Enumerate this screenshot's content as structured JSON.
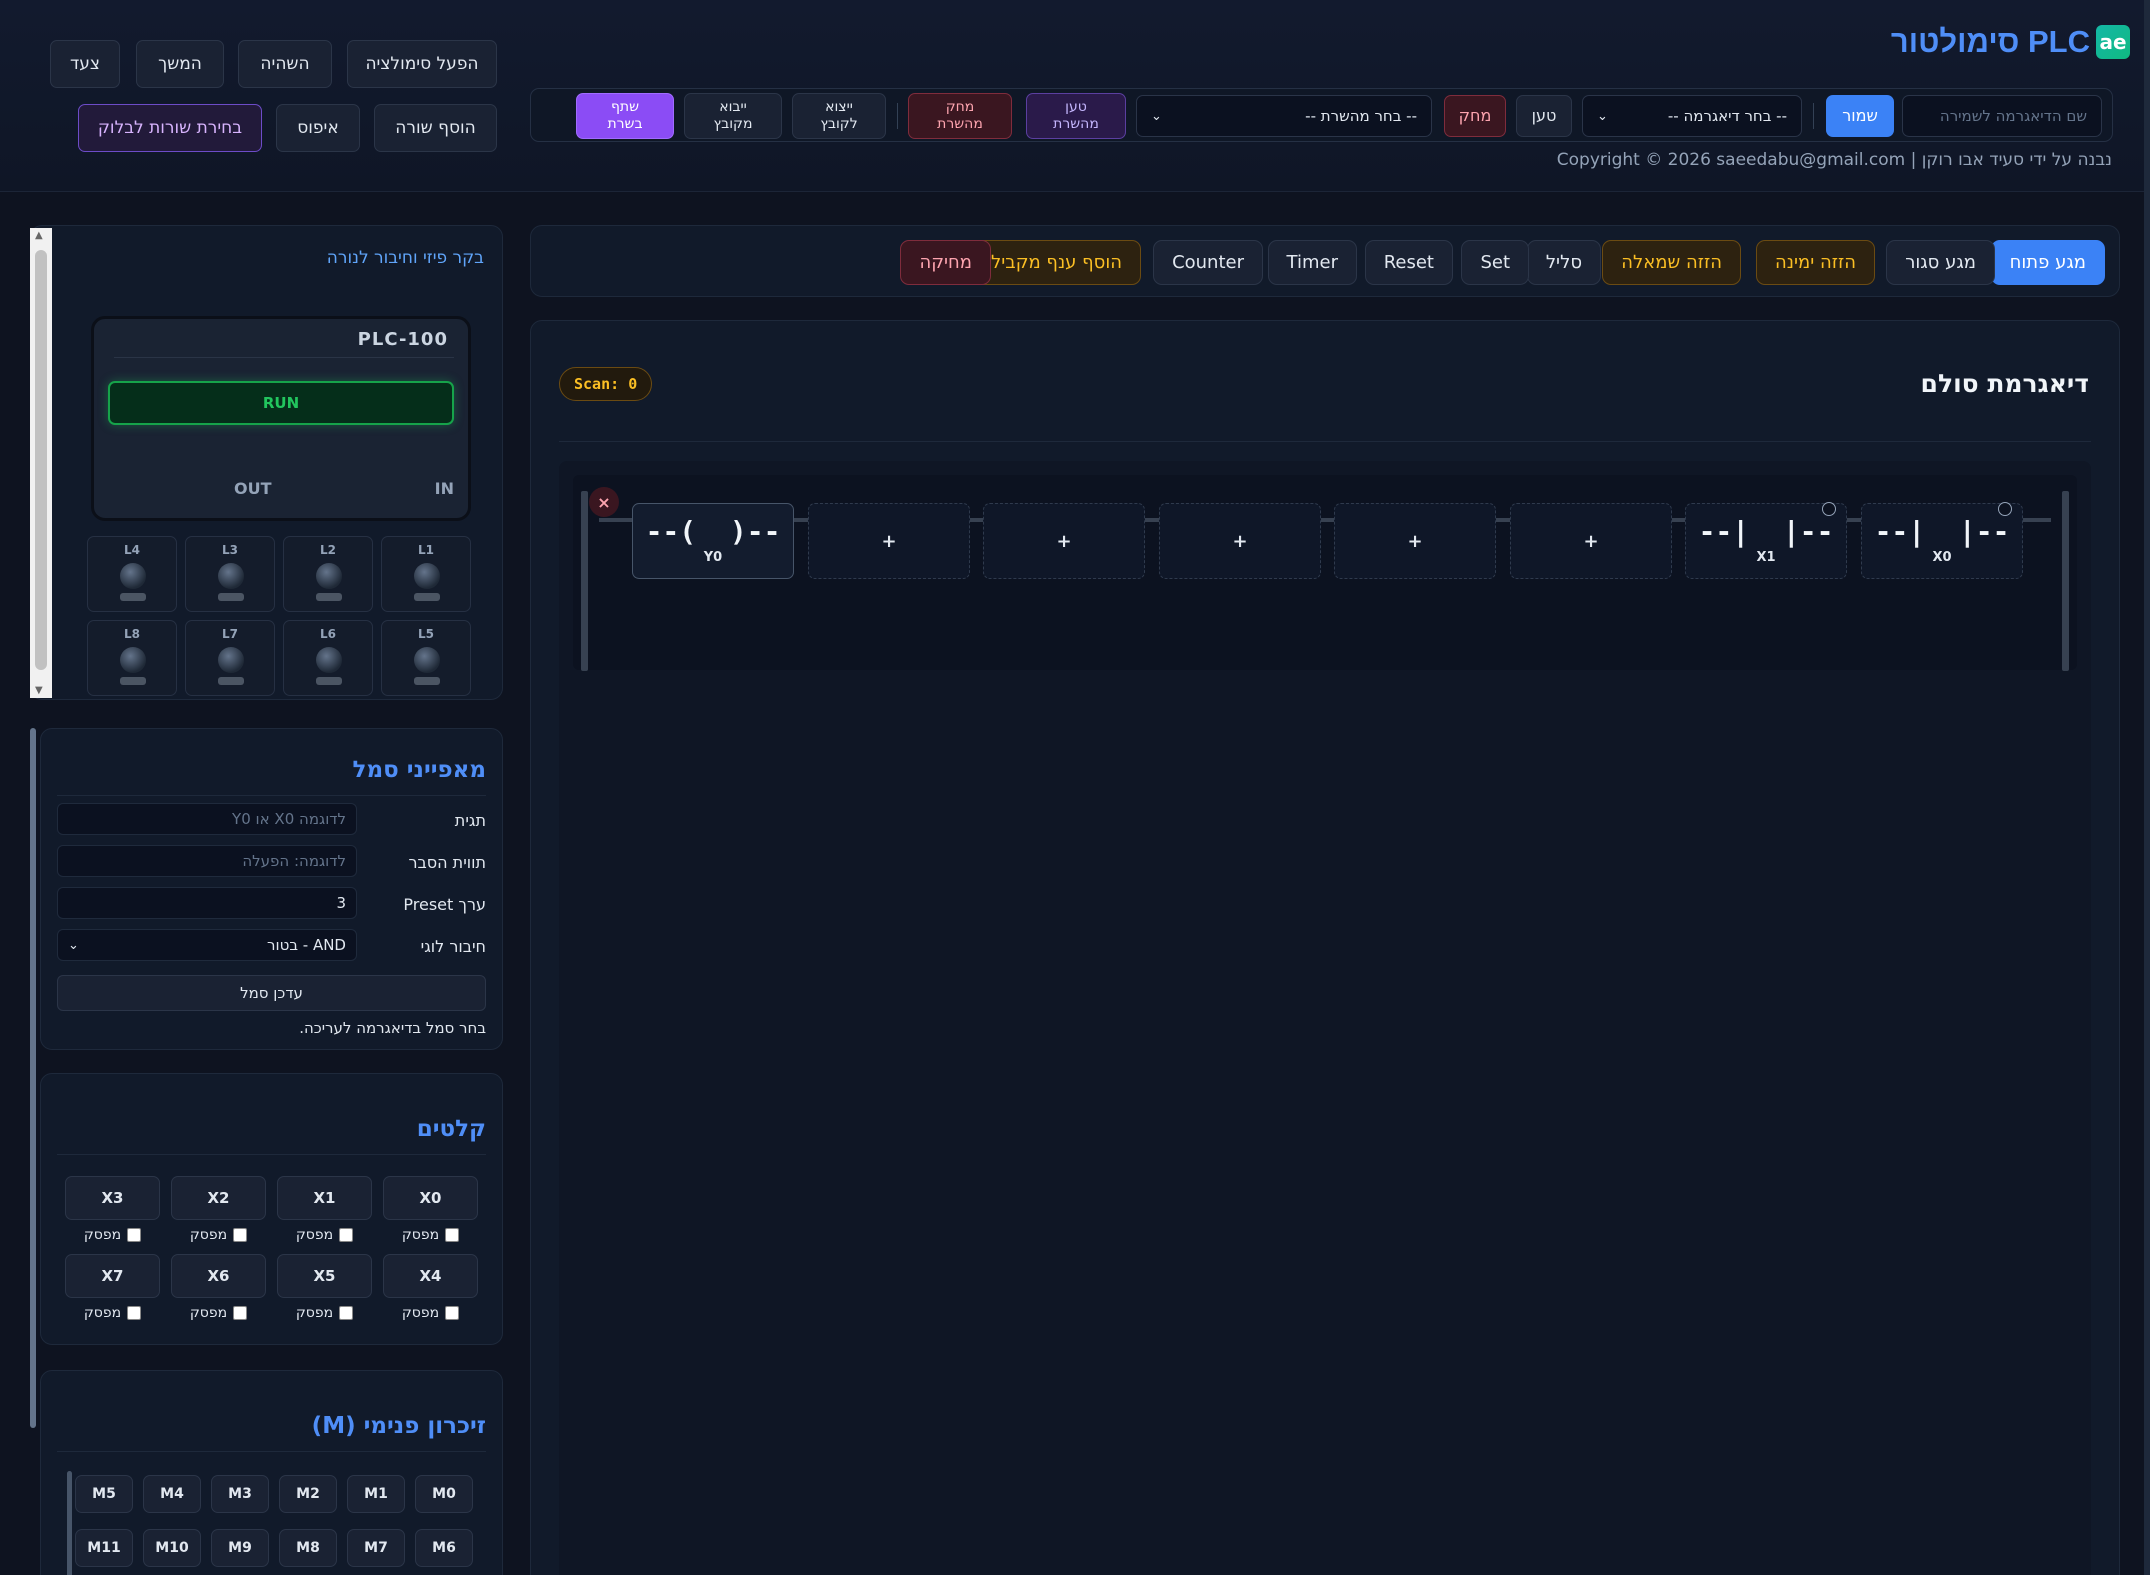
{
  "app": {
    "brand_name": "PLC סימולטור",
    "brand_badge": "ae",
    "copyright": "נבנה על ידי סעיד אבו רוקן | Copyright © 2026 saeedabu@gmail.com"
  },
  "savebar": {
    "name_placeholder": "שם הדיאגרמה לשמירה",
    "save": "שמור",
    "diagram_select": "-- בחר דיאגרמה --",
    "load": "טען",
    "delete": "מחק",
    "version_select": "-- בחר מהשרת --",
    "load_server_1": "טען",
    "load_server_2": "מהשרת",
    "delete_server_1": "מחק",
    "delete_server_2": "מהשרת",
    "export_1": "ייצוא",
    "export_2": "לקובץ",
    "import_1": "ייבוא",
    "import_2": "מקובץ",
    "share_1": "שתף",
    "share_2": "בשרת"
  },
  "sim_controls": {
    "start": "הפעל סימולציה",
    "pause": "השהיה",
    "resume": "המשך",
    "step": "צעד",
    "add_row": "הוסף שורה",
    "reset": "איפוס",
    "select_rows": "בחירת שורות לבלוק"
  },
  "toolbar": {
    "no_contact": "מגע פתוח",
    "nc_contact": "מגע סגור",
    "shift_right": "הזזה ימינה",
    "shift_left": "הזזה שמאלה",
    "coil": "סליל",
    "set": "Set",
    "reset": "Reset",
    "timer": "Timer",
    "counter": "Counter",
    "add_parallel": "הוסף ענף מקביל",
    "erase": "מחיקה"
  },
  "ladder": {
    "title": "דיאגרמת סולם",
    "scan_label": "Scan:",
    "scan_value": "0",
    "delete_rung": "×",
    "cells": [
      {
        "symbol": "--|  |--",
        "tag": "X0",
        "type": "contact"
      },
      {
        "symbol": "--|  |--",
        "tag": "X1",
        "type": "contact"
      },
      {
        "symbol": "+",
        "tag": "",
        "type": "empty"
      },
      {
        "symbol": "+",
        "tag": "",
        "type": "empty"
      },
      {
        "symbol": "+",
        "tag": "",
        "type": "empty"
      },
      {
        "symbol": "+",
        "tag": "",
        "type": "empty"
      },
      {
        "symbol": "+",
        "tag": "",
        "type": "empty"
      },
      {
        "symbol": "--(  )--",
        "tag": "Y0",
        "type": "coil"
      }
    ]
  },
  "plc": {
    "title": "בקר פיזי וחיבור לנורה",
    "model": "PLC-100",
    "status": "RUN",
    "in_label": "IN",
    "out_label": "OUT",
    "lamps": [
      "L1",
      "L2",
      "L3",
      "L4",
      "L5",
      "L6",
      "L7",
      "L8"
    ]
  },
  "props": {
    "title": "מאפייני סמל",
    "tag_label": "תגית",
    "tag_placeholder": "לדוגמה X0 או Y0",
    "desc_label": "תווית הסבר",
    "desc_placeholder": "לדוגמה: הפעלה",
    "preset_label": "ערך Preset",
    "preset_value": "3",
    "logic_label": "חיבור לוגי",
    "logic_value": "AND - בטור",
    "update": "עדכן סמל",
    "hint": "בחר סמל בדיאגרמה לעריכה."
  },
  "inputs": {
    "title": "קלטים",
    "latch_label": "מפסק",
    "items": [
      "X0",
      "X1",
      "X2",
      "X3",
      "X4",
      "X5",
      "X6",
      "X7"
    ]
  },
  "memory": {
    "title": "זיכרון פנימי (M)",
    "items": [
      "M0",
      "M1",
      "M2",
      "M3",
      "M4",
      "M5",
      "M6",
      "M7",
      "M8",
      "M9",
      "M10",
      "M11"
    ]
  }
}
